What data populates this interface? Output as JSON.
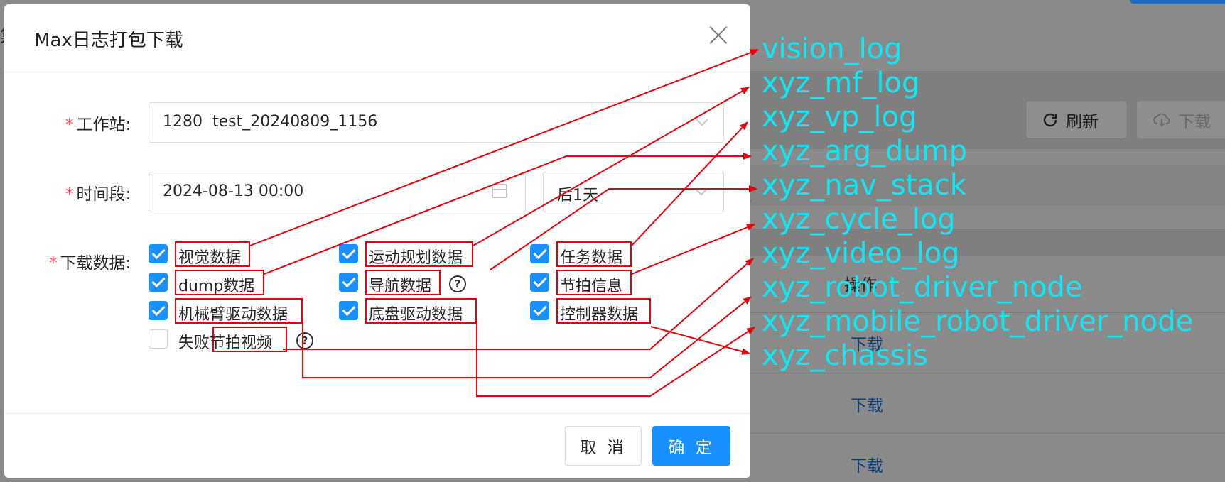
{
  "modal": {
    "title": "Max日志打包下载",
    "workstation_label": "工作站:",
    "workstation_value": "1280  test_20240809_1156",
    "period_label": "时间段:",
    "date_value": "2024-08-13 00:00",
    "range_value": "后1天",
    "download_data_label": "下载数据:",
    "checkboxes": [
      {
        "label": "视觉数据",
        "checked": true
      },
      {
        "label": "运动规划数据",
        "checked": true
      },
      {
        "label": "任务数据",
        "checked": true
      },
      {
        "label": "dump数据",
        "checked": true
      },
      {
        "label": "导航数据",
        "checked": true
      },
      {
        "label": "节拍信息",
        "checked": true
      },
      {
        "label": "机械臂驱动数据",
        "checked": true
      },
      {
        "label": "底盘驱动数据",
        "checked": true
      },
      {
        "label": "控制器数据",
        "checked": true
      },
      {
        "label": "失败节拍视频",
        "checked": false
      }
    ],
    "cancel_label": "取 消",
    "ok_label": "确 定"
  },
  "background": {
    "refresh_label": "刷新",
    "download_label": "下载",
    "table_header_action": "操作",
    "row_links": [
      "下载",
      "下载",
      "下载"
    ]
  },
  "annotations": [
    "vision_log",
    "xyz_mf_log",
    "xyz_vp_log",
    "xyz_arg_dump",
    "xyz_nav_stack",
    "xyz_cycle_log",
    "xyz_video_log",
    "xyz_robot_driver_node",
    "xyz_mobile_robot_driver_node",
    "xyz_chassis"
  ],
  "colors": {
    "primary": "#1890ff",
    "annotation_text": "#12e6f5",
    "annotation_line": "#e8000b",
    "required": "#ff4d4f"
  },
  "icons": [
    "close-icon",
    "chevron-down-icon",
    "calendar-icon",
    "check-icon",
    "question-circle-icon",
    "reload-icon",
    "cloud-download-icon"
  ]
}
